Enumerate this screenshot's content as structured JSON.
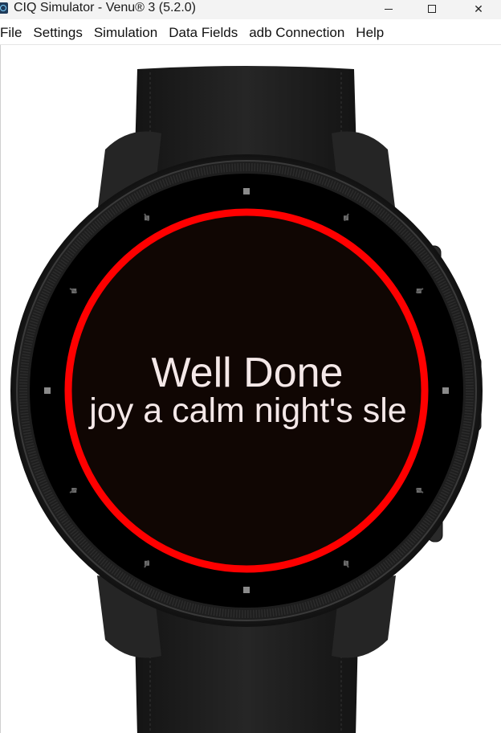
{
  "window": {
    "title": "CIQ Simulator - Venu® 3 (5.2.0)",
    "minimize_glyph": "—",
    "close_glyph": "✕"
  },
  "menu": {
    "items": [
      {
        "label": "File"
      },
      {
        "label": "Settings"
      },
      {
        "label": "Simulation"
      },
      {
        "label": "Data Fields"
      },
      {
        "label": "adb Connection"
      },
      {
        "label": "Help"
      }
    ]
  },
  "device": {
    "model": "Venu® 3",
    "screen_bg": "#100603",
    "ring_color": "#ff0000",
    "bezel_color": "#000000",
    "strap_color": "#1c1c1c"
  },
  "screen": {
    "title": "Well Done",
    "subtitle": "joy a calm night's sle"
  }
}
